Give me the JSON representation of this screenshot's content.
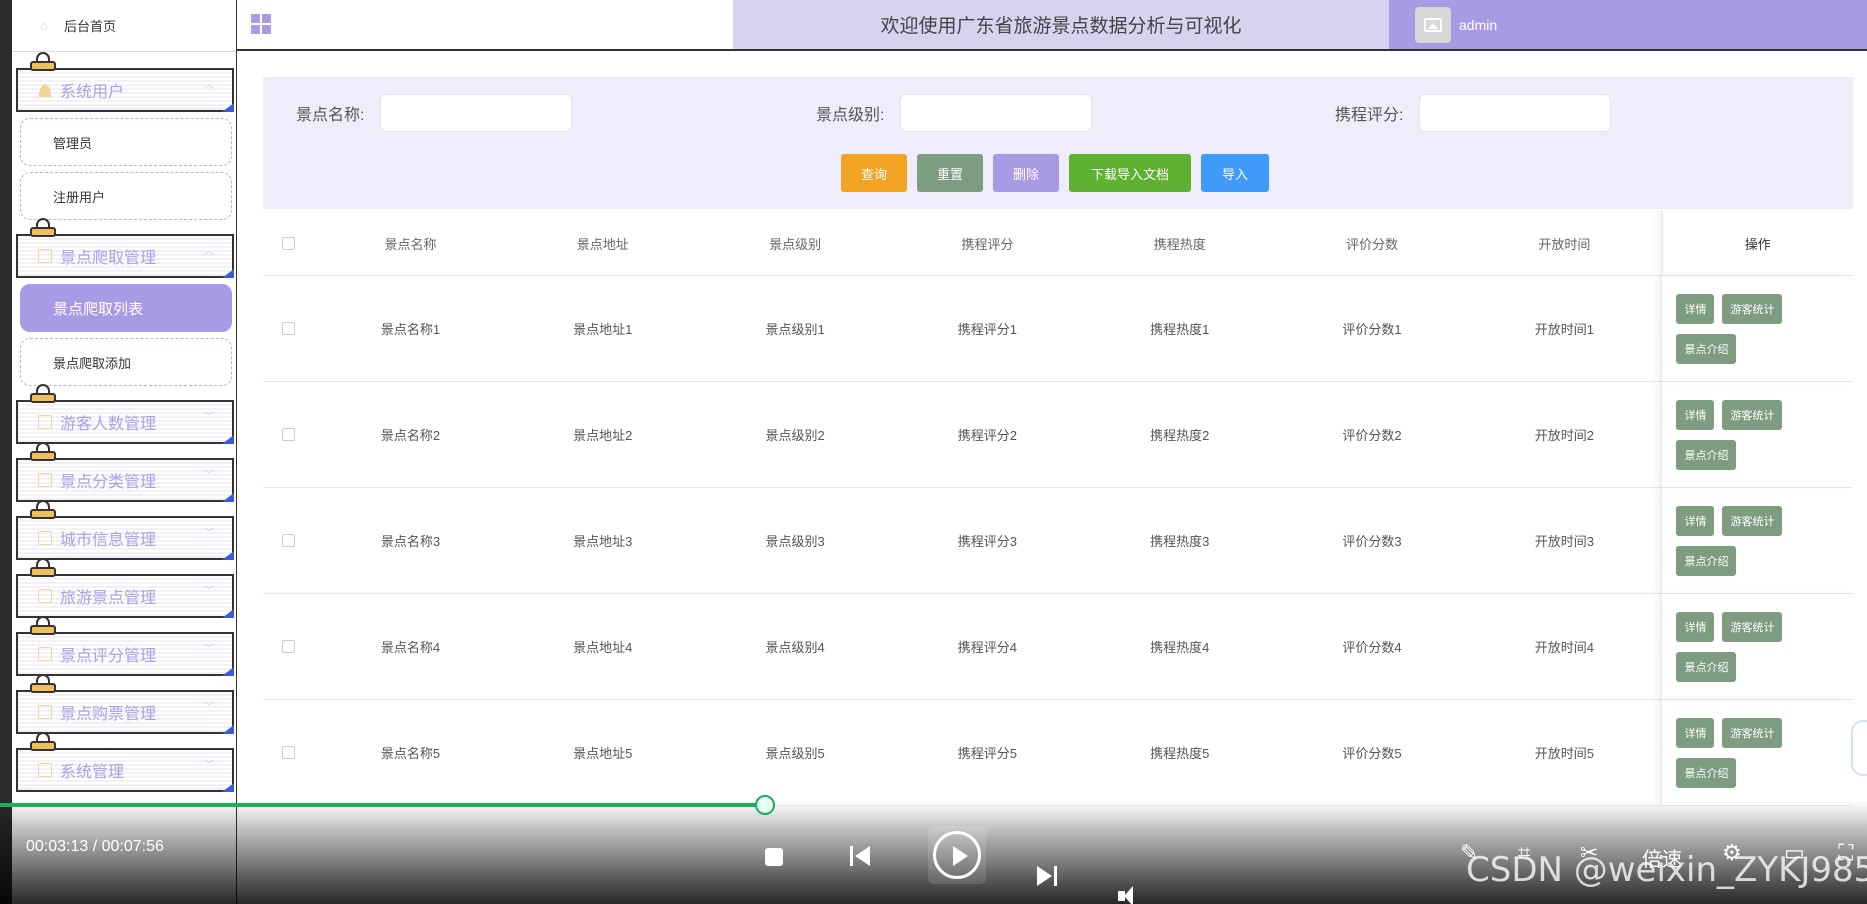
{
  "sidebar": {
    "home_label": "后台首页",
    "groups": [
      {
        "label": "系统用户"
      },
      {
        "label": "景点爬取管理"
      },
      {
        "label": "游客人数管理"
      },
      {
        "label": "景点分类管理"
      },
      {
        "label": "城市信息管理"
      },
      {
        "label": "旅游景点管理"
      },
      {
        "label": "景点评分管理"
      },
      {
        "label": "景点购票管理"
      },
      {
        "label": "系统管理"
      }
    ],
    "sub_items": {
      "admin": "管理员",
      "registered_users": "注册用户",
      "crawl_list": "景点爬取列表",
      "crawl_add": "景点爬取添加"
    }
  },
  "header": {
    "title": "欢迎使用广东省旅游景点数据分析与可视化",
    "username": "admin"
  },
  "search": {
    "fields": [
      {
        "label": "景点名称:",
        "value": ""
      },
      {
        "label": "景点级别:",
        "value": ""
      },
      {
        "label": "携程评分:",
        "value": ""
      }
    ],
    "buttons": {
      "query": "查询",
      "reset": "重置",
      "delete": "删除",
      "download": "下载导入文档",
      "import": "导入"
    }
  },
  "table": {
    "columns": [
      "景点名称",
      "景点地址",
      "景点级别",
      "携程评分",
      "携程热度",
      "评价分数",
      "开放时间",
      "操作"
    ],
    "rows": [
      [
        "景点名称1",
        "景点地址1",
        "景点级别1",
        "携程评分1",
        "携程热度1",
        "评价分数1",
        "开放时间1"
      ],
      [
        "景点名称2",
        "景点地址2",
        "景点级别2",
        "携程评分2",
        "携程热度2",
        "评价分数2",
        "开放时间2"
      ],
      [
        "景点名称3",
        "景点地址3",
        "景点级别3",
        "携程评分3",
        "携程热度3",
        "评价分数3",
        "开放时间3"
      ],
      [
        "景点名称4",
        "景点地址4",
        "景点级别4",
        "携程评分4",
        "携程热度4",
        "评价分数4",
        "开放时间4"
      ],
      [
        "景点名称5",
        "景点地址5",
        "景点级别5",
        "携程评分5",
        "携程热度5",
        "评价分数5",
        "开放时间5"
      ]
    ],
    "row_actions": [
      "详情",
      "游客统计",
      "景点介绍"
    ]
  },
  "player": {
    "time": "00:03:13 / 00:07:56",
    "progress": 0.4,
    "speed_label": "倍速",
    "watermark": "CSDN @weixin_ZYKJ985"
  },
  "colors": {
    "accent": "#a99ae6",
    "title_bg": "#d8d2ee",
    "query": "#f2a322",
    "reset": "#7d9c80",
    "download": "#5fb132",
    "import": "#3f9bf7",
    "progress": "#1bae5b"
  }
}
